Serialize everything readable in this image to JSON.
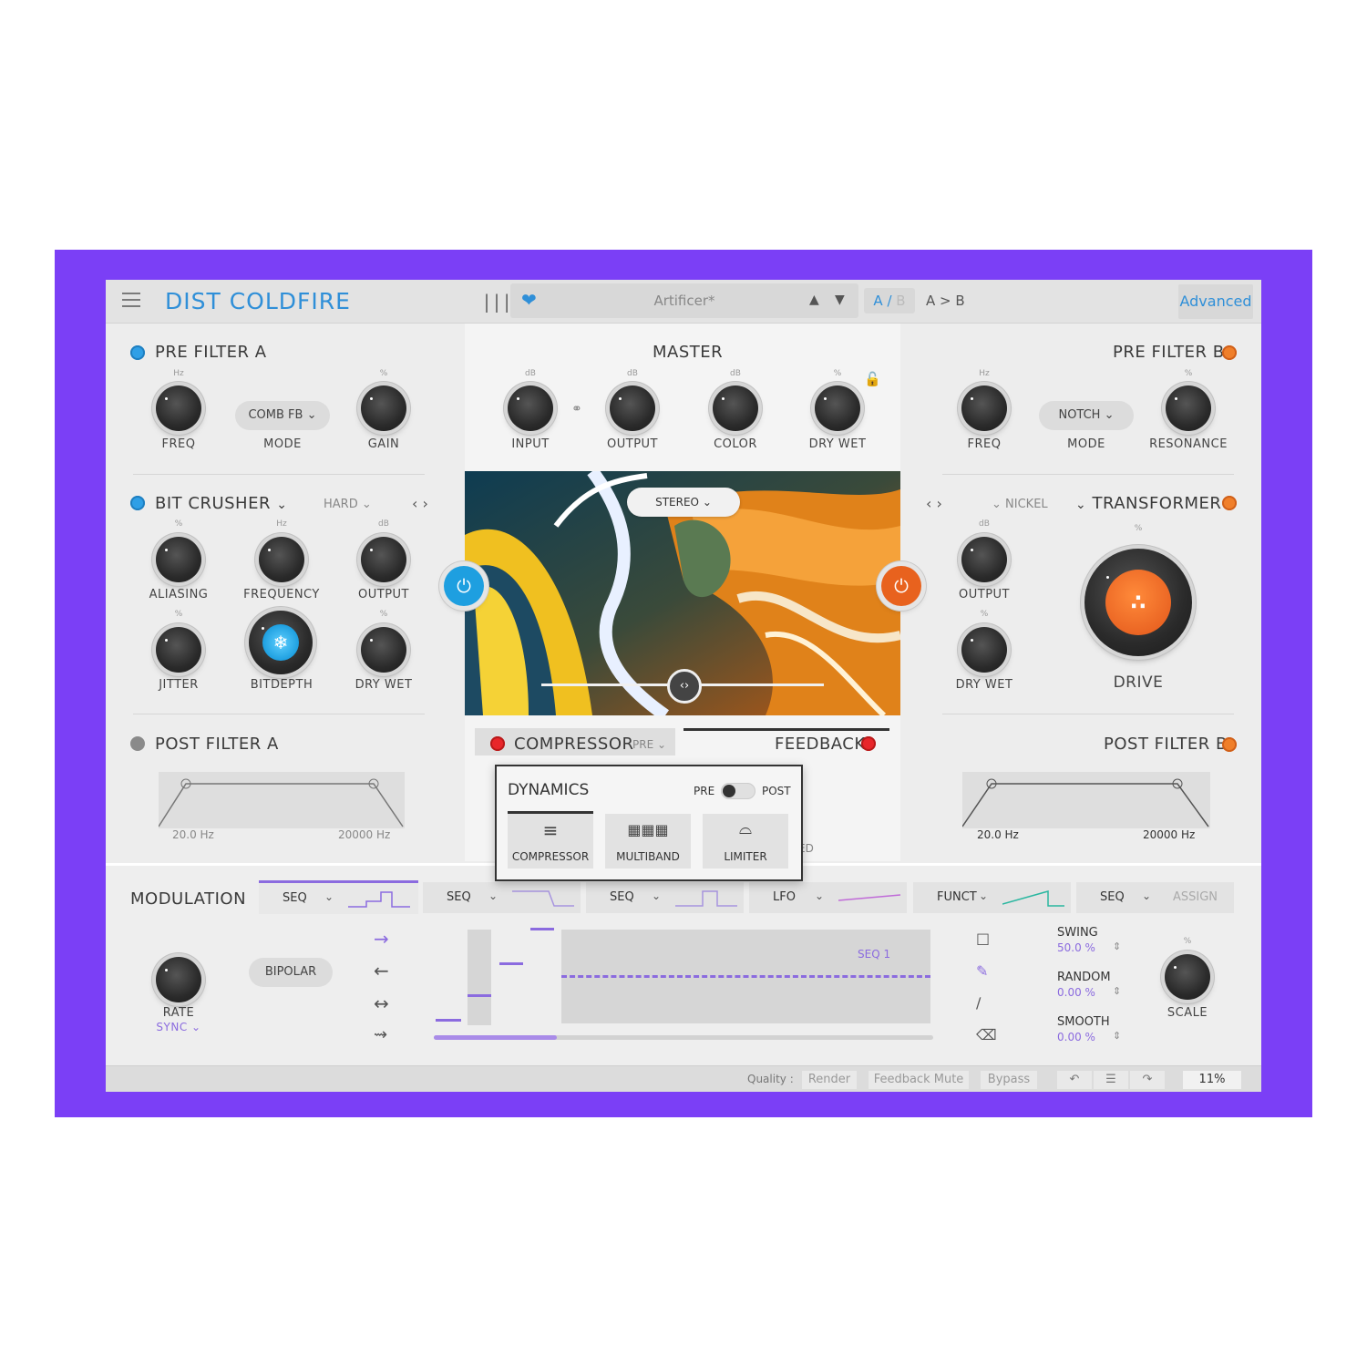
{
  "app": {
    "title": "DIST COLDFIRE",
    "preset_name": "Artificer*",
    "ab_a": "A",
    "ab_sep": "/",
    "ab_b": "B",
    "a_to_b": "A > B",
    "advanced": "Advanced"
  },
  "pre_filter_a": {
    "title": "PRE FILTER A",
    "freq_unit": "Hz",
    "gain_unit": "%",
    "freq": "FREQ",
    "mode_value": "COMB FB",
    "mode": "MODE",
    "gain": "GAIN"
  },
  "master": {
    "title": "MASTER",
    "input_unit": "dB",
    "output_unit": "dB",
    "color_unit": "dB",
    "drywet_unit": "%",
    "input": "INPUT",
    "output": "OUTPUT",
    "color": "COLOR",
    "dry_wet": "DRY  WET",
    "stereo": "STEREO"
  },
  "pre_filter_b": {
    "title": "PRE FILTER B",
    "freq_unit": "Hz",
    "res_unit": "%",
    "freq": "FREQ",
    "mode_value": "NOTCH",
    "mode": "MODE",
    "resonance": "RESONANCE"
  },
  "bit_crusher": {
    "title": "BIT CRUSHER",
    "type": "HARD",
    "aliasing_unit": "%",
    "freq_unit": "Hz",
    "output_unit": "dB",
    "jitter_unit": "%",
    "drywet_unit": "%",
    "aliasing": "ALIASING",
    "frequency": "FREQUENCY",
    "output": "OUTPUT",
    "jitter": "JITTER",
    "bitdepth": "BITDEPTH",
    "dry_wet": "DRY WET"
  },
  "transformer": {
    "title": "TRANSFORMER",
    "type": "NICKEL",
    "output_unit": "dB",
    "drywet_unit": "%",
    "drive_unit": "%",
    "output": "OUTPUT",
    "dry_wet": "DRY WET",
    "drive": "DRIVE"
  },
  "post_filter_a": {
    "title": "POST FILTER A",
    "low": "20.0 Hz",
    "high": "20000 Hz"
  },
  "post_filter_b": {
    "title": "POST FILTER B",
    "low": "20.0 Hz",
    "high": "20000 Hz"
  },
  "compressor": {
    "title": "COMPRESSOR",
    "position": "PRE"
  },
  "feedback": {
    "title": "FEEDBACK",
    "hidden_label": "ED"
  },
  "dynamics": {
    "title": "DYNAMICS",
    "pre": "PRE",
    "post": "POST",
    "compressor": "COMPRESSOR",
    "multiband": "MULTIBAND",
    "limiter": "LIMITER"
  },
  "modulation": {
    "title": "MODULATION",
    "tabs": [
      "SEQ",
      "SEQ",
      "SEQ",
      "LFO",
      "FUNCT",
      "SEQ"
    ],
    "assign": "ASSIGN",
    "rate": "RATE",
    "sync": "SYNC",
    "bipolar": "BIPOLAR",
    "seq_label": "SEQ 1",
    "swing": "SWING",
    "swing_value": "50.0 %",
    "random": "RANDOM",
    "random_value": "0.00 %",
    "smooth": "SMOOTH",
    "smooth_value": "0.00 %",
    "scale_unit": "%",
    "scale": "SCALE"
  },
  "status": {
    "quality": "Quality :",
    "render": "Render",
    "feedback_mute": "Feedback Mute",
    "bypass": "Bypass",
    "cpu": "11%"
  },
  "colors": {
    "accent_blue": "#2f8fd8",
    "orange": "#f07f2a",
    "purple_bg": "#7b3ff6",
    "seq_purple": "#8b6bdf"
  }
}
